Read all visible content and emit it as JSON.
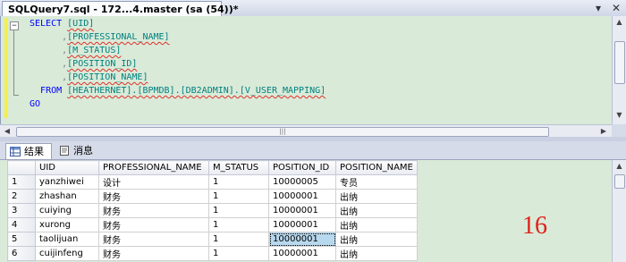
{
  "document_tab": {
    "title": "SQLQuery7.sql - 172...4.master (sa (54))*"
  },
  "strip_buttons": {
    "dropdown": "▾",
    "close": "✕"
  },
  "editor": {
    "collapse_symbol": "−",
    "lines": [
      {
        "indent": "",
        "keyword": "SELECT",
        "sep": " ",
        "ident": "[UID]"
      },
      {
        "indent": "      ",
        "keyword": "",
        "sep": ",",
        "ident": "[PROFESSIONAL_NAME]"
      },
      {
        "indent": "      ",
        "keyword": "",
        "sep": ",",
        "ident": "[M_STATUS]"
      },
      {
        "indent": "      ",
        "keyword": "",
        "sep": ",",
        "ident": "[POSITION_ID]"
      },
      {
        "indent": "      ",
        "keyword": "",
        "sep": ",",
        "ident": "[POSITION_NAME]"
      },
      {
        "indent": "  ",
        "keyword": "FROM",
        "sep": " ",
        "ident": "[HEATHERNET].[BPMDB].[DB2ADMIN].[V_USER_MAPPING]"
      },
      {
        "indent": "",
        "keyword": "GO",
        "sep": "",
        "ident": ""
      }
    ]
  },
  "scroll": {
    "up": "▲",
    "down": "▼",
    "left": "◀",
    "right": "▶",
    "grip": "|||"
  },
  "results_tabs": [
    {
      "label": "结果",
      "active": true
    },
    {
      "label": "消息",
      "active": false
    }
  ],
  "grid": {
    "columns": [
      "UID",
      "PROFESSIONAL_NAME",
      "M_STATUS",
      "POSITION_ID",
      "POSITION_NAME"
    ],
    "rows": [
      {
        "n": "1",
        "cells": [
          "yanzhiwei",
          "设计",
          "1",
          "10000005",
          "专员"
        ]
      },
      {
        "n": "2",
        "cells": [
          "zhashan",
          "财务",
          "1",
          "10000001",
          "出纳"
        ]
      },
      {
        "n": "3",
        "cells": [
          "cuiying",
          "财务",
          "1",
          "10000001",
          "出纳"
        ]
      },
      {
        "n": "4",
        "cells": [
          "xurong",
          "财务",
          "1",
          "10000001",
          "出纳"
        ]
      },
      {
        "n": "5",
        "cells": [
          "taolijuan",
          "财务",
          "1",
          "10000001",
          "出纳"
        ]
      },
      {
        "n": "6",
        "cells": [
          "cuijinfeng",
          "财务",
          "1",
          "10000001",
          "出纳"
        ]
      }
    ],
    "selected": {
      "row": 4,
      "col": 3
    }
  },
  "annotation": "16",
  "colors": {
    "editor_bg": "#d9ead8",
    "keyword": "#0000ff",
    "identifier": "#008080",
    "squiggle": "#e0302a",
    "annotation": "#e0201a",
    "selection": "#b8d8ee"
  }
}
